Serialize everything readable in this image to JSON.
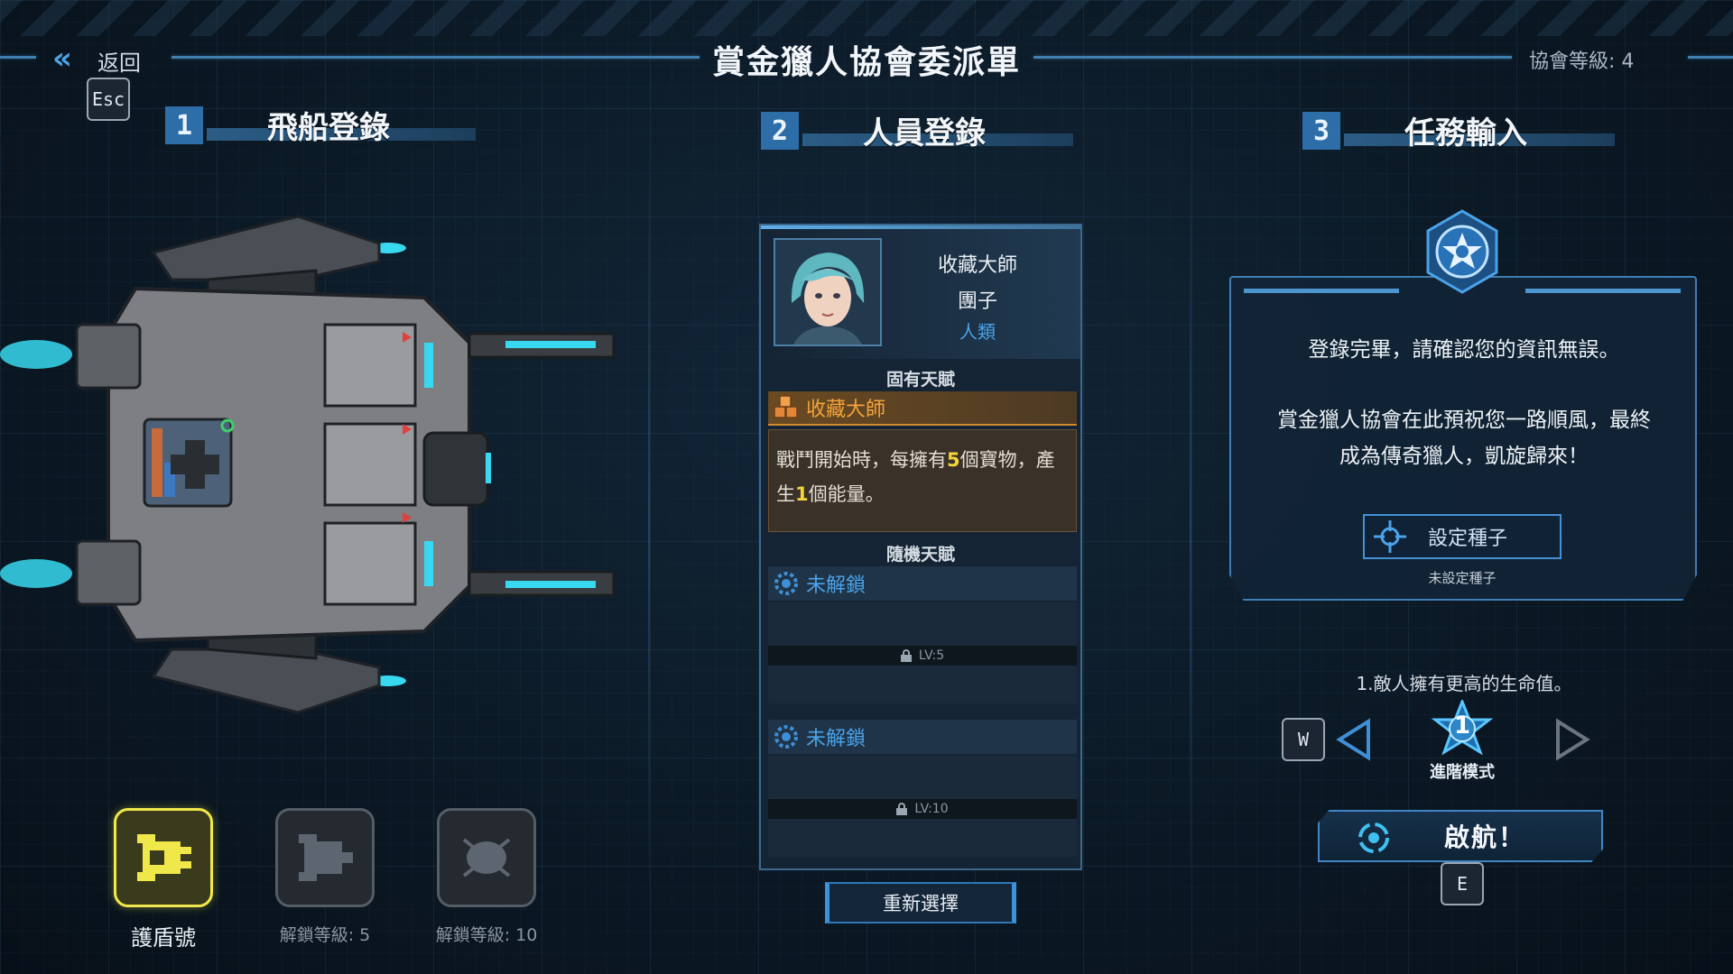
{
  "header": {
    "back_label": "返回",
    "esc_key": "Esc",
    "title": "賞金獵人協會委派單",
    "guild_level": "協會等級: 4"
  },
  "sections": [
    {
      "number": "1",
      "title": "飛船登錄"
    },
    {
      "number": "2",
      "title": "人員登錄"
    },
    {
      "number": "3",
      "title": "任務輸入"
    }
  ],
  "ships": [
    {
      "label": "護盾號",
      "state": "selected"
    },
    {
      "label": "解鎖等級: 5",
      "state": "locked"
    },
    {
      "label": "解鎖等級: 10",
      "state": "locked"
    }
  ],
  "crew": {
    "title": "收藏大師",
    "name": "團子",
    "race": "人類",
    "fixed_header": "固有天賦",
    "fixed_talent": {
      "name": "收藏大師",
      "desc_before": "戰鬥開始時，每擁有",
      "desc_num1": "5",
      "desc_mid": "個寶物，產生",
      "desc_num2": "1",
      "desc_after": "個能量。"
    },
    "random_header": "隨機天賦",
    "random_talents": [
      {
        "name": "未解鎖",
        "lock": "LV:5"
      },
      {
        "name": "未解鎖",
        "lock": "LV:10"
      }
    ],
    "reselect_label": "重新選擇"
  },
  "mission": {
    "line1": "登錄完畢，請確認您的資訊無誤。",
    "line2": "賞金獵人協會在此預祝您一路順風，最終",
    "line3": "成為傳奇獵人，凱旋歸來！",
    "seed_button": "設定種子",
    "seed_status": "未設定種子",
    "modifier": "1.敵人擁有更高的生命值。",
    "mode_key": "W",
    "mode_level": "1",
    "mode_label": "進階模式",
    "launch_label": "啟航！",
    "launch_key": "E"
  },
  "colors": {
    "accent": "#4aa3ea",
    "selected_ship": "#f0e84a",
    "talent_orange": "#f3a43a",
    "highlight_yellow": "#f4d53a"
  },
  "icons": [
    "back-chevron-icon",
    "crate-icon",
    "gear-badge-icon",
    "lock-icon",
    "crosshair-icon",
    "star-emblem-icon",
    "arrow-left-icon",
    "arrow-right-icon",
    "portal-icon"
  ]
}
